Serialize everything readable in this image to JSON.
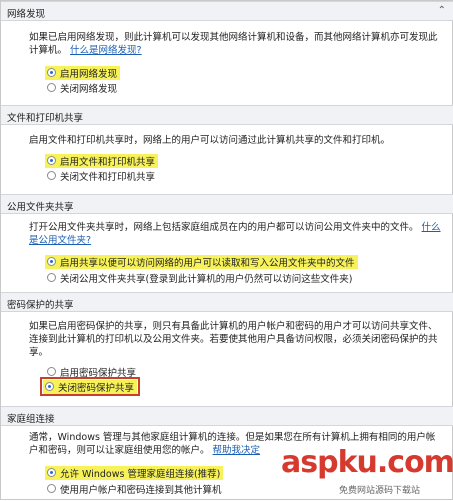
{
  "sections": [
    {
      "title": "网络发现",
      "lines": [
        "如果已启用网络发现，则此计算机可以发现其他网络计算机和设备，而其他网络计算机亦可发现此",
        "计算机。"
      ],
      "link": "什么是网络发现?",
      "options": [
        {
          "label": "启用网络发现",
          "checked": true,
          "highlighted": true
        },
        {
          "label": "关闭网络发现",
          "checked": false,
          "highlighted": false
        }
      ]
    },
    {
      "title": "文件和打印机共享",
      "lines": [
        "启用文件和打印机共享时，网络上的用户可以访问通过此计算机共享的文件和打印机。"
      ],
      "options": [
        {
          "label": "启用文件和打印机共享",
          "checked": true,
          "highlighted": true
        },
        {
          "label": "关闭文件和打印机共享",
          "checked": false,
          "highlighted": false
        }
      ]
    },
    {
      "title": "公用文件夹共享",
      "lines": [
        "打开公用文件夹共享时，网络上包括家庭组成员在内的用户都可以访问公用文件夹中的文件。",
        "是公用文件夹?"
      ],
      "link_prefix": "什么",
      "options": [
        {
          "label": "启用共享以便可以访问网络的用户可以读取和写入公用文件夹中的文件",
          "checked": true,
          "highlighted": true
        },
        {
          "label": "关闭公用文件夹共享(登录到此计算机的用户仍然可以访问这些文件夹)",
          "checked": false,
          "highlighted": false
        }
      ]
    },
    {
      "title": "密码保护的共享",
      "lines": [
        "如果已启用密码保护的共享，则只有具备此计算机的用户帐户和密码的用户才可以访问共享文件、",
        "连接到此计算机的打印机以及公用文件夹。若要使其他用户具备访问权限，必须关闭密码保护的共",
        "享。"
      ],
      "options": [
        {
          "label": "启用密码保护共享",
          "checked": false,
          "highlighted": false
        },
        {
          "label": "关闭密码保护共享",
          "checked": true,
          "highlighted": true
        }
      ]
    },
    {
      "title": "家庭组连接",
      "lines": [
        "通常，Windows 管理与其他家庭组计算机的连接。但是如果您在所有计算机上拥有相同的用户帐",
        "户和密码，则可以让家庭组使用您的帐户。"
      ],
      "link": "帮助我决定",
      "options": [
        {
          "label": "允许 Windows 管理家庭组连接(推荐)",
          "checked": true,
          "highlighted": true
        },
        {
          "label": "使用用户帐户和密码连接到其他计算机",
          "checked": false,
          "highlighted": false
        }
      ]
    }
  ],
  "watermark": {
    "main": "aspku.com",
    "sub": "免费网站源码下载站"
  },
  "icons": {
    "collapse": "chevron-up-icon",
    "radio": "radio-button-icon"
  },
  "colors": {
    "highlight": "#f7f25a",
    "link": "#1a5fb4",
    "callout": "#c8402a",
    "watermark": "#d63a2f"
  }
}
